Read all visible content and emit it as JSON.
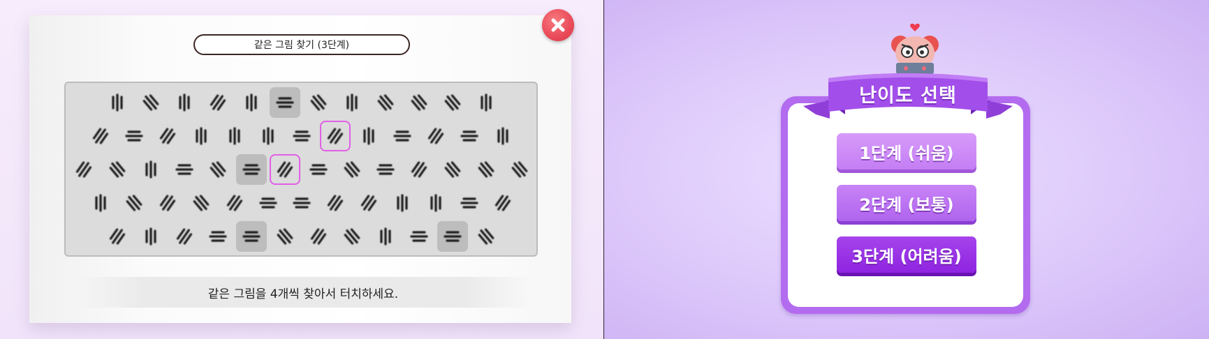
{
  "game": {
    "title": "같은 그림 찾기 (3단계)",
    "instruction": "같은 그림을 4개씩 찾아서 터치하세요.",
    "grid": {
      "rows": [
        [
          "v",
          "d2",
          "v",
          "d1",
          "v",
          "h",
          "d2",
          "v",
          "d2",
          "d2",
          "d2",
          "v"
        ],
        [
          "d1",
          "h",
          "d1",
          "v",
          "v",
          "v",
          "h",
          "d1",
          "v",
          "h",
          "d1",
          "h",
          "v"
        ],
        [
          "d1",
          "d2",
          "v",
          "h",
          "d2",
          "h",
          "d1",
          "h",
          "d2",
          "h",
          "d1",
          "d2",
          "d2",
          "d2"
        ],
        [
          "v",
          "d2",
          "d1",
          "d2",
          "d1",
          "h",
          "h",
          "d1",
          "d1",
          "v",
          "v",
          "h",
          "d1"
        ],
        [
          "d1",
          "v",
          "d1",
          "h",
          "h",
          "d2",
          "d1",
          "d2",
          "v",
          "h",
          "h",
          "d2"
        ]
      ],
      "shaded": [
        [
          0,
          5
        ],
        [
          2,
          5
        ],
        [
          4,
          4
        ],
        [
          4,
          10
        ]
      ],
      "selected": [
        [
          1,
          7
        ],
        [
          2,
          6
        ]
      ]
    }
  },
  "menu": {
    "title": "난이도 선택",
    "levels": [
      "1단계 (쉬움)",
      "2단계 (보통)",
      "3단계 (어려움)"
    ]
  },
  "colors": {
    "accent": "#9b3de6",
    "close": "#e94a58",
    "selection": "#e060e6"
  }
}
